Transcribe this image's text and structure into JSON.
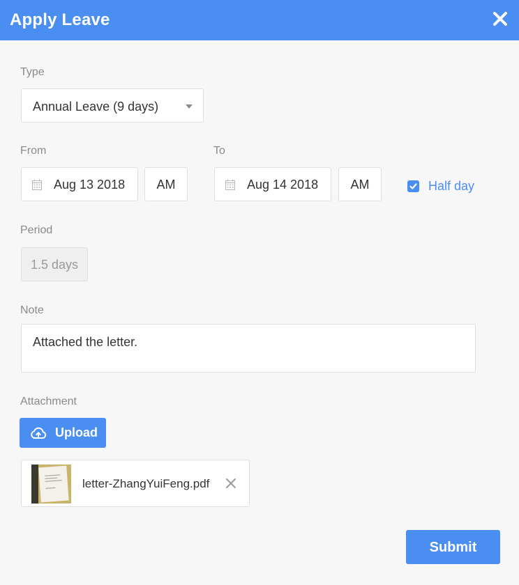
{
  "dialog": {
    "title": "Apply Leave",
    "close_icon": "close-icon"
  },
  "type": {
    "label": "Type",
    "selected": "Annual Leave (9 days)"
  },
  "from": {
    "label": "From",
    "date": "Aug 13 2018",
    "ampm": "AM"
  },
  "to": {
    "label": "To",
    "date": "Aug 14 2018",
    "ampm": "AM"
  },
  "half_day": {
    "label": "Half day",
    "checked": true
  },
  "period": {
    "label": "Period",
    "value": "1.5 days"
  },
  "note": {
    "label": "Note",
    "value": "Attached the letter."
  },
  "attachment": {
    "label": "Attachment",
    "upload_label": "Upload",
    "files": [
      {
        "name": "letter-ZhangYuiFeng.pdf"
      }
    ]
  },
  "actions": {
    "submit_label": "Submit"
  },
  "colors": {
    "accent": "#4b8ef1",
    "background": "#f7f7f7",
    "label": "#8a8a8a"
  }
}
